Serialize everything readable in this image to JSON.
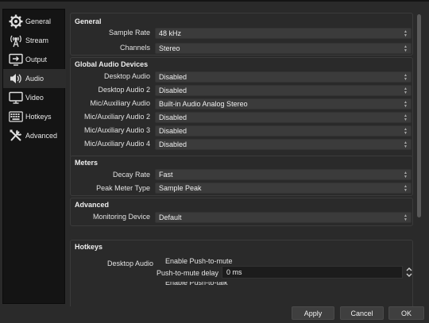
{
  "sidebar": {
    "items": [
      {
        "label": "General",
        "icon": "gear-icon"
      },
      {
        "label": "Stream",
        "icon": "broadcast-icon"
      },
      {
        "label": "Output",
        "icon": "output-icon"
      },
      {
        "label": "Audio",
        "icon": "speaker-icon",
        "active": true
      },
      {
        "label": "Video",
        "icon": "monitor-icon"
      },
      {
        "label": "Hotkeys",
        "icon": "keyboard-icon"
      },
      {
        "label": "Advanced",
        "icon": "tools-icon"
      }
    ]
  },
  "general": {
    "title": "General",
    "sample_rate_label": "Sample Rate",
    "sample_rate_value": "48 kHz",
    "channels_label": "Channels",
    "channels_value": "Stereo"
  },
  "global_audio": {
    "title": "Global Audio Devices",
    "rows": [
      {
        "label": "Desktop Audio",
        "value": "Disabled"
      },
      {
        "label": "Desktop Audio 2",
        "value": "Disabled"
      },
      {
        "label": "Mic/Auxiliary Audio",
        "value": "Built-in Audio Analog Stereo"
      },
      {
        "label": "Mic/Auxiliary Audio 2",
        "value": "Disabled"
      },
      {
        "label": "Mic/Auxiliary Audio 3",
        "value": "Disabled"
      },
      {
        "label": "Mic/Auxiliary Audio 4",
        "value": "Disabled"
      }
    ]
  },
  "meters": {
    "title": "Meters",
    "decay_rate_label": "Decay Rate",
    "decay_rate_value": "Fast",
    "peak_meter_label": "Peak Meter Type",
    "peak_meter_value": "Sample Peak"
  },
  "advanced": {
    "title": "Advanced",
    "monitoring_label": "Monitoring Device",
    "monitoring_value": "Default"
  },
  "hotkeys": {
    "title": "Hotkeys",
    "source_label": "Desktop Audio",
    "enable_ptm_label": "Enable Push-to-mute",
    "ptm_delay_label": "Push-to-mute delay",
    "ptm_delay_value": "0 ms",
    "enable_ptt_label": "Enable Push-to-talk"
  },
  "buttons": {
    "apply": "Apply",
    "cancel": "Cancel",
    "ok": "OK"
  },
  "colors": {
    "window_bg": "#2a2a2a",
    "sidebar_bg": "#141414",
    "combo_bg": "#3b3b3b",
    "input_bg": "#1c1c1c"
  }
}
